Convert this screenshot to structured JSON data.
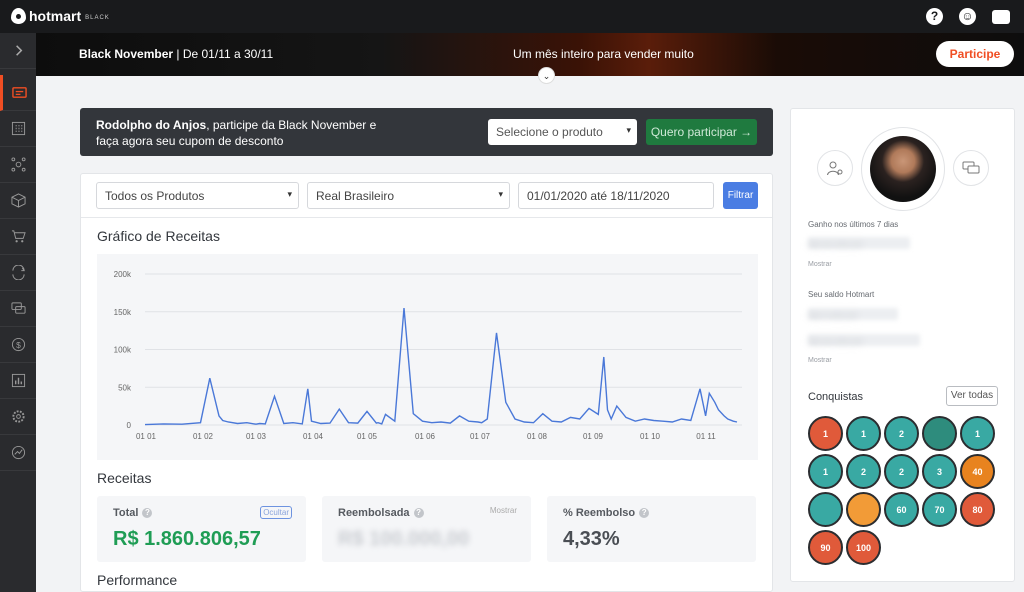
{
  "topbar": {
    "brand": "hotmart",
    "brand_sub": "BLACK",
    "icons": [
      "help-icon",
      "community-icon",
      "chat-icon"
    ]
  },
  "banner": {
    "title": "Black November",
    "dates": " | De 01/11 a 30/11",
    "tagline": "Um mês inteiro para vender muito",
    "cta": "Participe"
  },
  "promo": {
    "user_name": "Rodolpho do Anjos",
    "text": ", participe da Black November e faça agora seu cupom de desconto",
    "select_placeholder": "Selecione o produto",
    "button": "Quero participar →"
  },
  "filters": {
    "product": "Todos os Produtos",
    "currency": "Real Brasileiro",
    "date_range": "01/01/2020 até 18/11/2020",
    "button": "Filtrar"
  },
  "chart_title": "Gráfico de Receitas",
  "chart_data": {
    "type": "line",
    "title": "Gráfico de Receitas",
    "xlabel": "",
    "ylabel": "",
    "ylim": [
      0,
      200000
    ],
    "y_ticks": [
      "0",
      "50k",
      "100k",
      "150k",
      "200k"
    ],
    "x_ticks": [
      "01 01",
      "01 02",
      "01 03",
      "01 04",
      "01 05",
      "01 06",
      "01 07",
      "01 08",
      "01 09",
      "01 10",
      "01 11"
    ],
    "grid": true,
    "color": "#4a78d8",
    "series": [
      {
        "x_day": [
          0,
          10,
          20,
          30,
          35,
          40,
          42,
          45,
          50,
          55,
          60,
          62,
          65,
          70,
          75,
          80,
          85,
          88,
          90,
          95,
          100,
          105,
          110,
          115,
          120,
          125,
          126,
          128,
          130,
          135,
          140,
          145,
          150,
          155,
          160,
          165,
          170,
          175,
          180,
          182,
          185,
          190,
          195,
          200,
          205,
          210,
          215,
          220,
          225,
          230,
          235,
          240,
          245,
          248,
          250,
          252,
          255,
          260,
          265,
          270,
          275,
          280,
          285,
          290,
          295,
          300,
          303,
          305,
          308,
          310,
          313,
          315,
          318,
          320
        ],
        "values": [
          500,
          1500,
          1000,
          3000,
          62000,
          12000,
          6000,
          4000,
          2000,
          3000,
          1000,
          2000,
          1500,
          38000,
          2000,
          3000,
          1500,
          48000,
          5000,
          2000,
          2500,
          21000,
          3000,
          2500,
          18000,
          2500,
          3000,
          1500,
          14000,
          5000,
          155000,
          15000,
          5000,
          3000,
          4000,
          2500,
          12000,
          5000,
          4000,
          3000,
          8000,
          122000,
          30000,
          8000,
          4000,
          3000,
          15000,
          5000,
          4000,
          10000,
          8000,
          22000,
          14000,
          90000,
          20000,
          8000,
          25000,
          10000,
          5000,
          8000,
          6000,
          5000,
          4000,
          8000,
          6000,
          48000,
          12000,
          42000,
          30000,
          20000,
          12000,
          8000,
          5000,
          4000
        ]
      }
    ]
  },
  "revenue_title": "Receitas",
  "stats": [
    {
      "label": "Total",
      "value": "R$ 1.860.806,57",
      "action": "Ocultar",
      "color": "#1f9d55"
    },
    {
      "label": "Reembolsada",
      "value": "R$ 100.000,00",
      "action": "Mostrar",
      "color": "#c9ccd1"
    },
    {
      "label": "% Reembolso",
      "value": "4,33%",
      "action": "",
      "color": "#4a4e54"
    }
  ],
  "performance_title": "Performance",
  "profile": {
    "earnings_label": "Ganho nos últimos 7 dias",
    "earnings_value": "R$ 00.000,00",
    "earnings_show": "Mostrar",
    "balance_label": "Seu saldo Hotmart",
    "balance_value_1": "R$ 0.000,00",
    "balance_value_2": "R$ 00.000,00",
    "balance_show": "Mostrar",
    "achievements_title": "Conquistas",
    "see_all": "Ver todas",
    "badges": [
      "1",
      "1",
      "2",
      "",
      "1",
      "1",
      "2",
      "2",
      "3",
      "40",
      "",
      "",
      "60",
      "70",
      "80",
      "90",
      "100"
    ]
  }
}
